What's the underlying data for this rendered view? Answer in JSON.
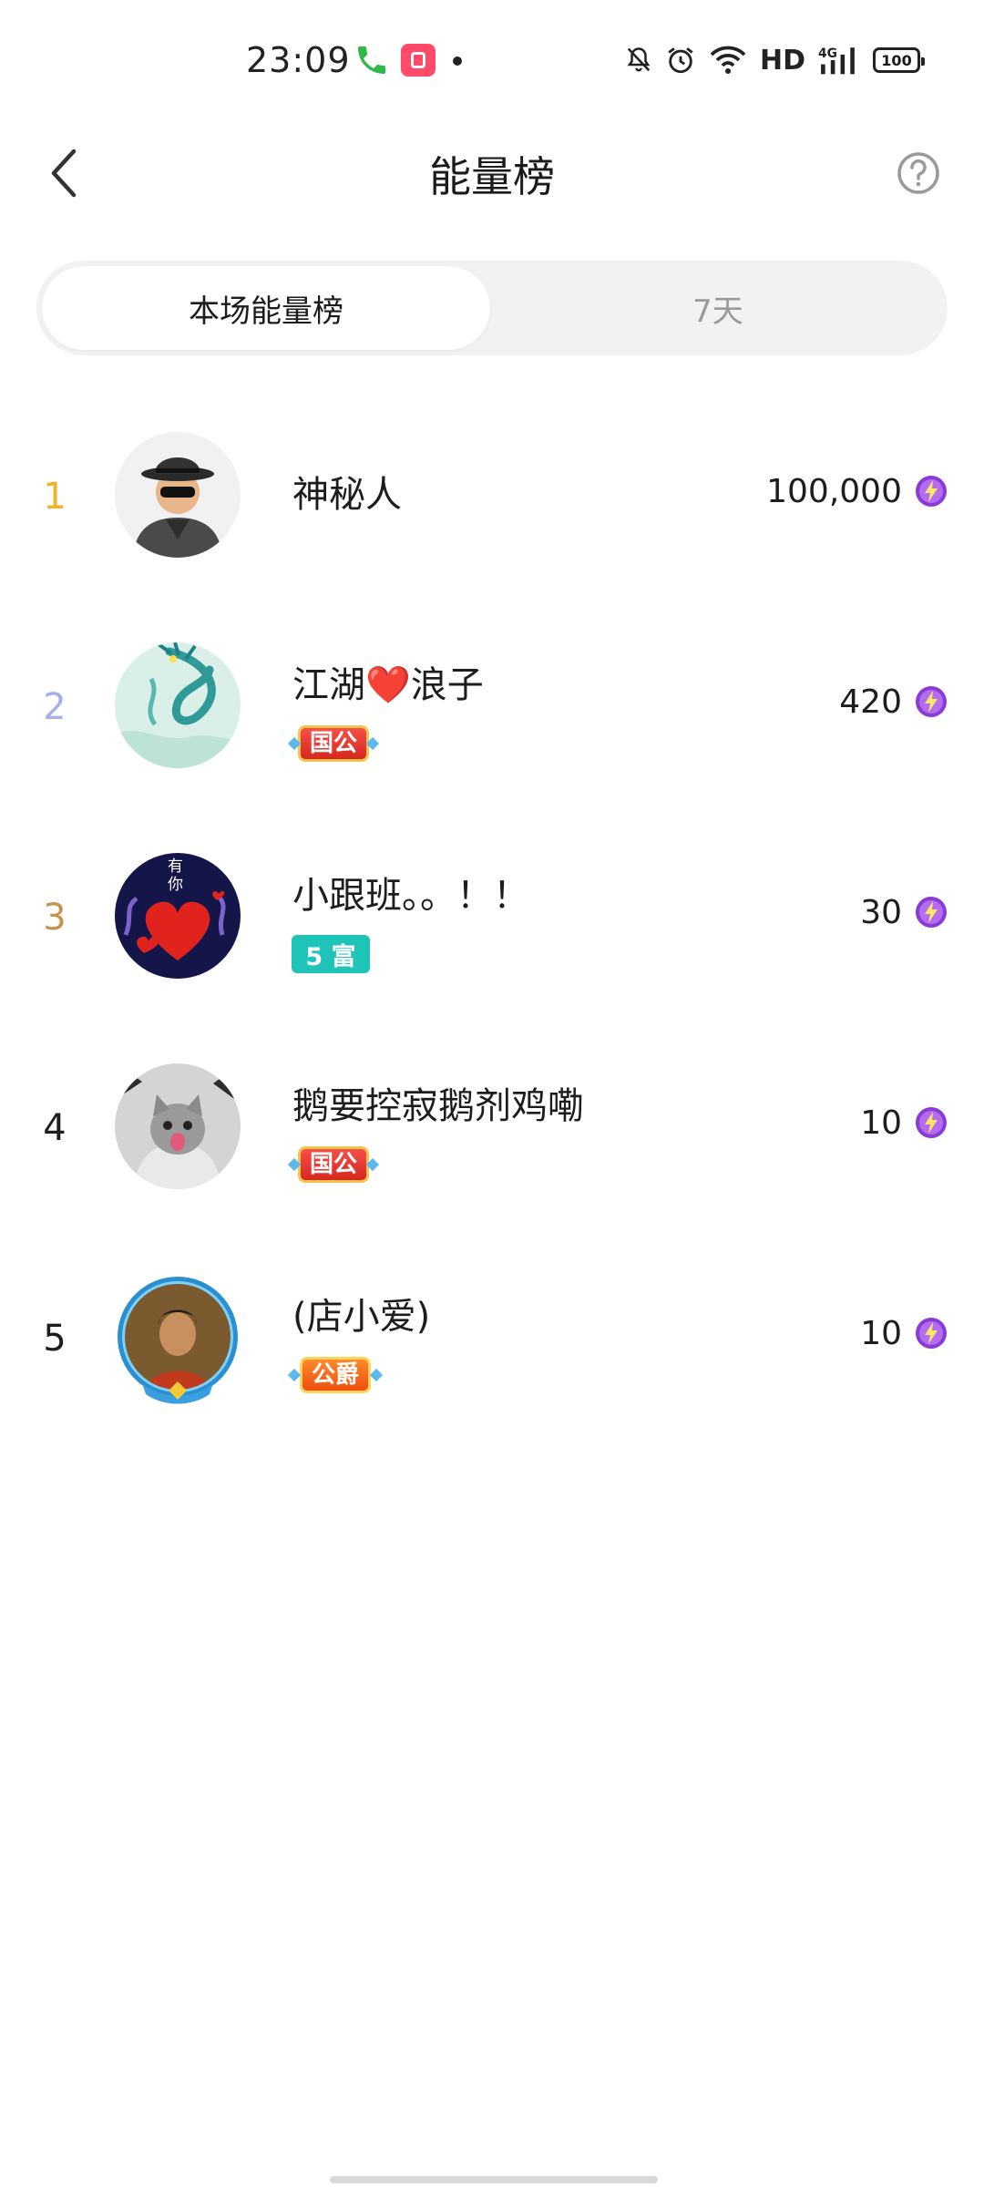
{
  "status_bar": {
    "time": "23:09",
    "network": "HD",
    "battery": "100"
  },
  "header": {
    "title": "能量榜"
  },
  "tabs": [
    {
      "label": "本场能量榜",
      "active": true
    },
    {
      "label": "7天",
      "active": false
    }
  ],
  "ranking": [
    {
      "rank": "1",
      "name": "神秘人",
      "badge": "",
      "score": "100,000",
      "rank_color": "#f0b323"
    },
    {
      "rank": "2",
      "name": "江湖❤️浪子",
      "badge": "国公",
      "score": "420",
      "rank_color": "#a8aee8"
    },
    {
      "rank": "3",
      "name": "小跟班。。！！",
      "badge": "5 富",
      "score": "30",
      "rank_color": "#c59252"
    },
    {
      "rank": "4",
      "name": "鹅要控寂鹅剂鸡嘞",
      "badge": "国公",
      "score": "10",
      "rank_color": "#1d1d1d"
    },
    {
      "rank": "5",
      "name": "(店小爱)",
      "badge": "公爵",
      "score": "10",
      "rank_color": "#1d1d1d"
    }
  ],
  "avatar_texts": {
    "rank3": "有\n你"
  },
  "colors": {
    "accent_purple": "#8a3bd6",
    "tab_bg": "#f2f2f2"
  }
}
